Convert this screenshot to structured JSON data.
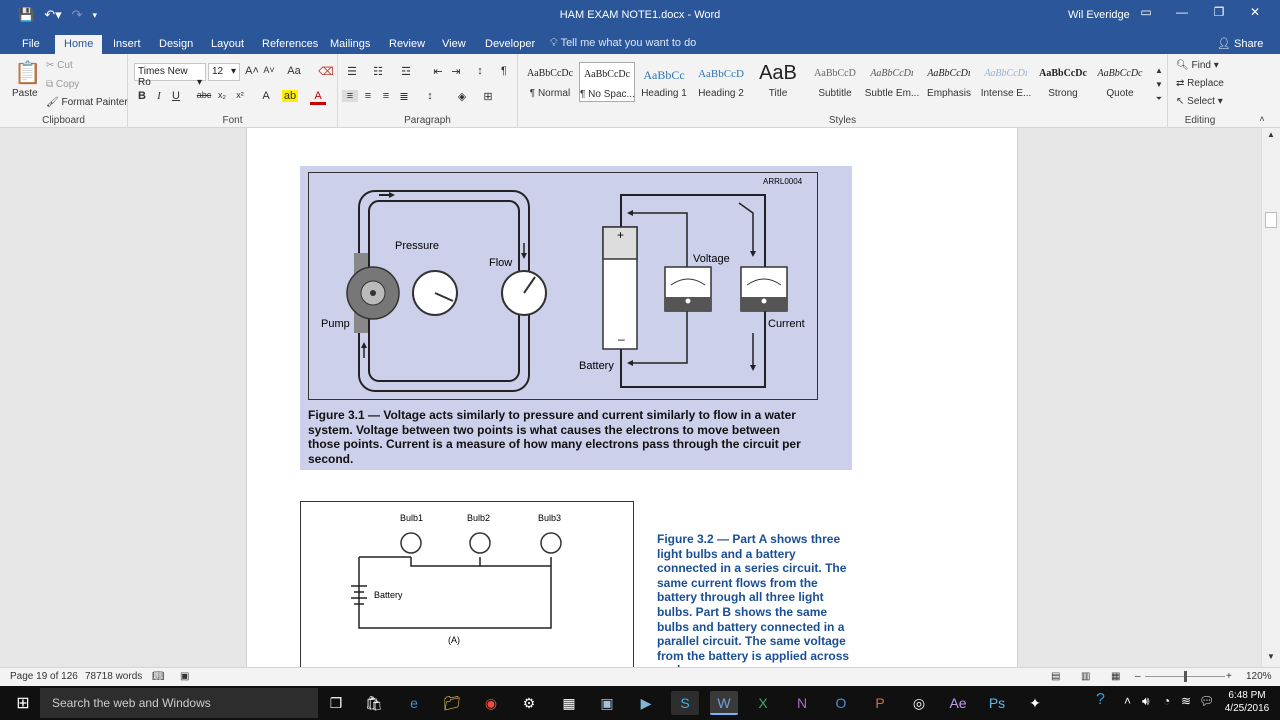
{
  "window": {
    "title": "HAM EXAM NOTE1.docx - Word",
    "user": "Wil Everidge"
  },
  "tabs": [
    "File",
    "Home",
    "Insert",
    "Design",
    "Layout",
    "References",
    "Mailings",
    "Review",
    "View",
    "Developer"
  ],
  "tell_me": "Tell me what you want to do",
  "share": "Share",
  "clipboard": {
    "paste": "Paste",
    "cut": "Cut",
    "copy": "Copy",
    "format_painter": "Format Painter",
    "label": "Clipboard"
  },
  "font": {
    "name": "Times New Ro",
    "size": "12",
    "label": "Font"
  },
  "paragraph": {
    "label": "Paragraph"
  },
  "styles": {
    "label": "Styles",
    "items": [
      {
        "preview": "AaBbCcDc",
        "name": "¶ Normal"
      },
      {
        "preview": "AaBbCcDc",
        "name": "¶ No Spac..."
      },
      {
        "preview": "AaBbCc",
        "name": "Heading 1"
      },
      {
        "preview": "AaBbCcD",
        "name": "Heading 2"
      },
      {
        "preview": "AaB",
        "name": "Title"
      },
      {
        "preview": "AaBbCcD",
        "name": "Subtitle"
      },
      {
        "preview": "AaBbCcDı",
        "name": "Subtle Em..."
      },
      {
        "preview": "AaBbCcDı",
        "name": "Emphasis"
      },
      {
        "preview": "AaBbCcDı",
        "name": "Intense E..."
      },
      {
        "preview": "AaBbCcDc",
        "name": "Strong"
      },
      {
        "preview": "AaBbCcDc",
        "name": "Quote"
      }
    ]
  },
  "editing": {
    "find": "Find",
    "replace": "Replace",
    "select": "Select",
    "label": "Editing"
  },
  "document": {
    "figure1": {
      "code": "ARRL0004",
      "labels": {
        "pressure": "Pressure",
        "flow": "Flow",
        "pump": "Pump",
        "voltage": "Voltage",
        "current": "Current",
        "battery": "Battery"
      },
      "caption": "Figure 3.1 — Voltage acts similarly to pressure and current similarly to flow in a water system. Voltage between two points is what causes the electrons to move between those points. Current is a measure of how many electrons pass through the circuit per second."
    },
    "figure2": {
      "bulbs": [
        "Bulb1",
        "Bulb2",
        "Bulb3"
      ],
      "battery": "Battery",
      "part": "(A)",
      "caption": "Figure 3.2 — Part A shows three light bulbs and a battery connected in a series circuit. The same current flows from the battery through all three light bulbs. Part B shows the same bulbs and battery connected in a parallel circuit. The same voltage from the battery is applied across each"
    }
  },
  "status": {
    "page": "Page 19 of 126",
    "words": "78718 words",
    "zoom": "120%"
  },
  "taskbar": {
    "search_placeholder": "Search the web and Windows",
    "time": "6:48 PM",
    "date": "4/25/2016"
  }
}
